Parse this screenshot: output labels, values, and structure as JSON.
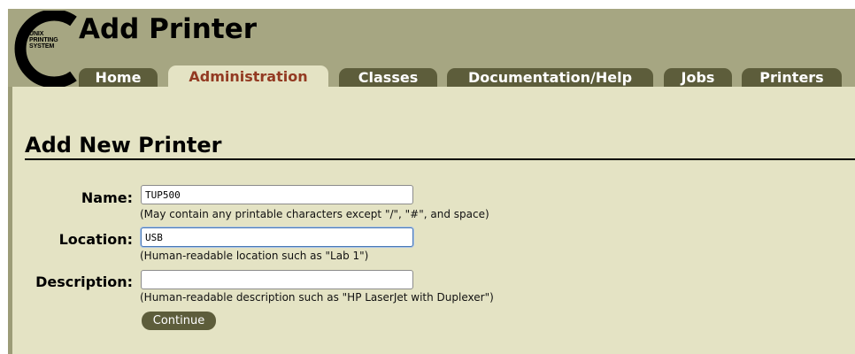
{
  "header": {
    "title": "Add Printer",
    "logo_text": [
      "UNIX",
      "PRINTING",
      "SYSTEM"
    ]
  },
  "tabs": [
    {
      "label": "Home",
      "active": false
    },
    {
      "label": "Administration",
      "active": true
    },
    {
      "label": "Classes",
      "active": false
    },
    {
      "label": "Documentation/Help",
      "active": false
    },
    {
      "label": "Jobs",
      "active": false
    },
    {
      "label": "Printers",
      "active": false
    }
  ],
  "form": {
    "heading": "Add New Printer",
    "name": {
      "label": "Name:",
      "value": "TUP500",
      "hint": "(May contain any printable characters except \"/\", \"#\", and space)"
    },
    "location": {
      "label": "Location:",
      "value": "USB",
      "hint": "(Human-readable location such as \"Lab 1\")"
    },
    "description": {
      "label": "Description:",
      "value": "",
      "hint": "(Human-readable description such as \"HP LaserJet with Duplexer\")"
    },
    "continue_label": "Continue"
  },
  "colors": {
    "header_bg": "#a6a682",
    "content_bg": "#e4e3c4",
    "tab_bg": "#5d5d3b",
    "active_tab_text": "#933a22"
  }
}
